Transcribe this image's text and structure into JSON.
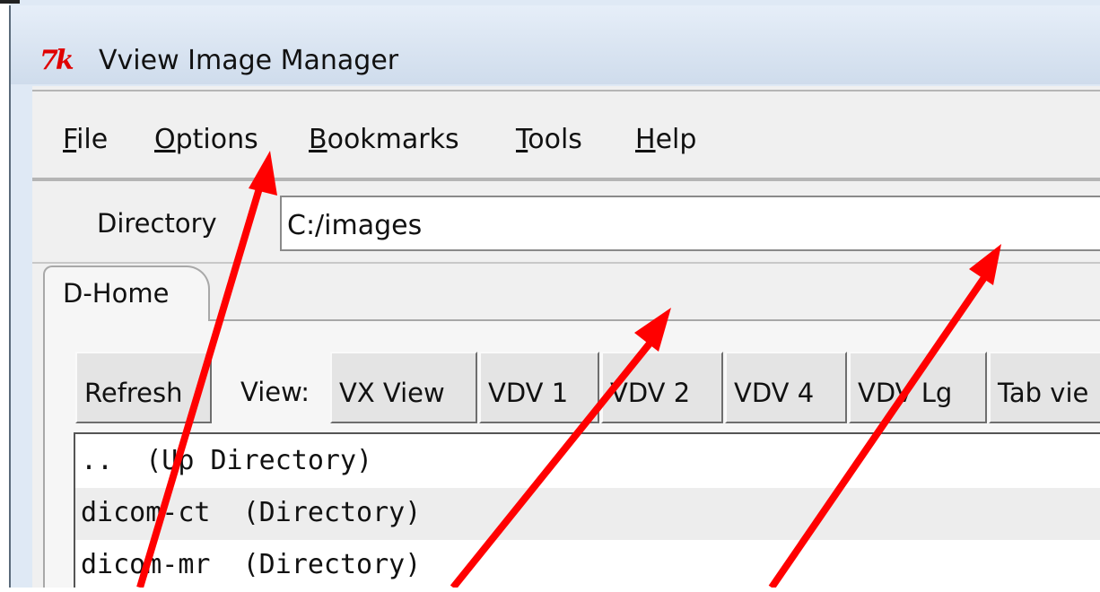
{
  "window": {
    "logo": "7k",
    "title": "Vview Image Manager"
  },
  "menubar": {
    "items": [
      {
        "first": "F",
        "rest": "ile"
      },
      {
        "first": "O",
        "rest": "ptions"
      },
      {
        "first": "B",
        "rest": "ookmarks"
      },
      {
        "first": "T",
        "rest": "ools"
      },
      {
        "first": "H",
        "rest": "elp"
      }
    ]
  },
  "directory": {
    "label": "Directory",
    "value": "C:/images"
  },
  "tab": {
    "label": "D-Home"
  },
  "toolbar": {
    "refresh": "Refresh",
    "view_label": "View:",
    "views": [
      "VX View",
      "VDV 1",
      "VDV 2",
      "VDV 4",
      "VDV Lg",
      "Tab vie"
    ]
  },
  "list": {
    "rows": [
      "..  (Up Directory)",
      "dicom-ct  (Directory)",
      "dicom-mr  (Directory)"
    ]
  },
  "colors": {
    "arrow": "#ff0000",
    "logo": "#e00000",
    "titlebar": "#dfe9f5"
  }
}
